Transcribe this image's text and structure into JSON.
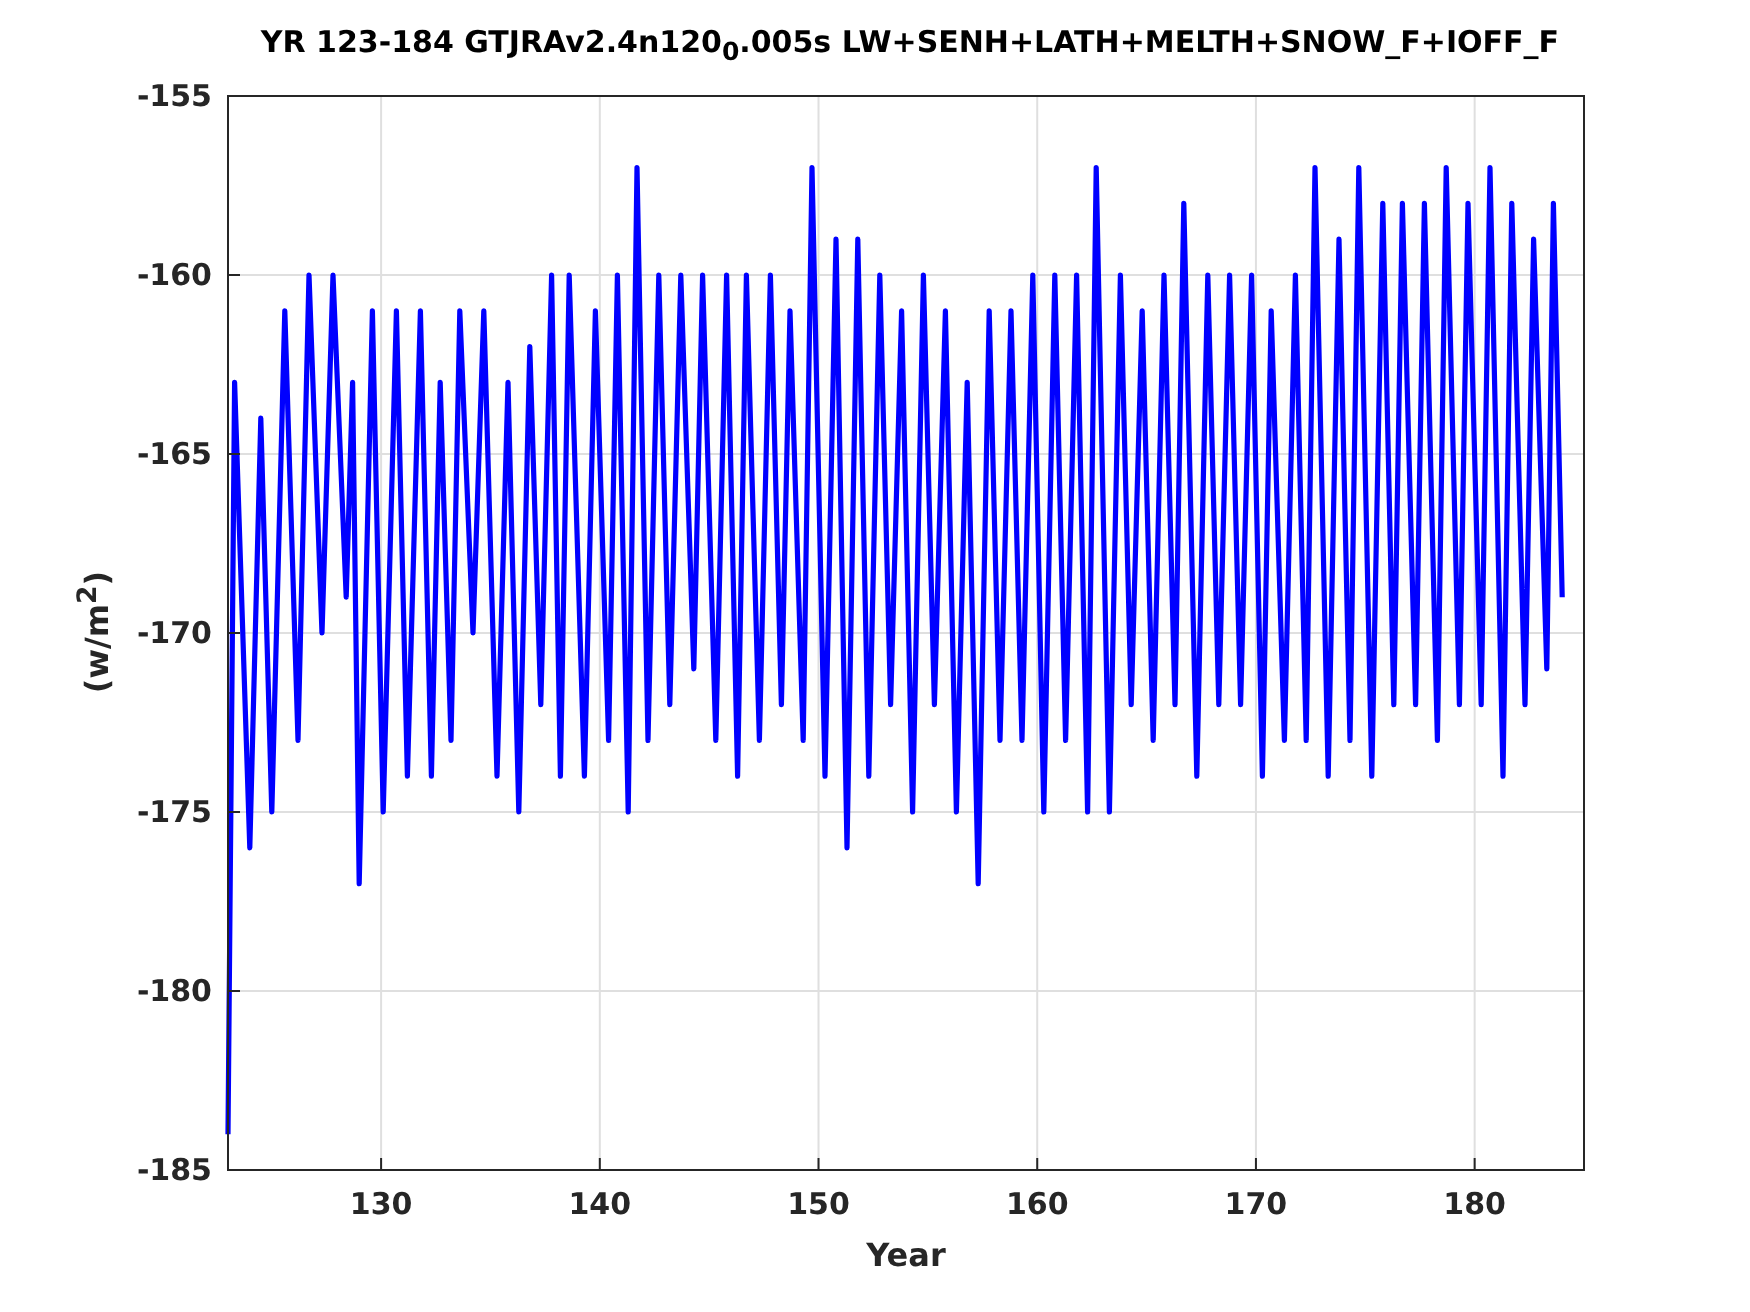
{
  "figure": {
    "chart_data": {
      "type": "line",
      "title": "YR 123-184 GTJRAv2.4n120$_{0}$.005s LW+SENH+LATH+MELTH+SNOW_F+IOFF_F",
      "xlabel": "Year",
      "ylabel": "(w/m$^{2}$)",
      "xlim": [
        123,
        185
      ],
      "ylim": [
        -185,
        -155
      ],
      "grid": true,
      "xticks": [
        130,
        140,
        150,
        160,
        170,
        180
      ],
      "yticks": [
        -185,
        -180,
        -175,
        -170,
        -165,
        -160,
        -155
      ],
      "x": [
        123,
        123.3,
        124,
        124.5,
        125,
        125.6,
        126.2,
        126.7,
        127.3,
        127.8,
        128.4,
        128.7,
        129,
        129.6,
        130.1,
        130.7,
        131.2,
        131.8,
        132.3,
        132.7,
        133.2,
        133.6,
        134.2,
        134.7,
        135.3,
        135.8,
        136.3,
        136.8,
        137.3,
        137.8,
        138.2,
        138.6,
        139.3,
        139.8,
        140.4,
        140.8,
        141.3,
        141.7,
        142.2,
        142.7,
        143.2,
        143.7,
        144.3,
        144.7,
        145.3,
        145.8,
        146.3,
        146.7,
        147.3,
        147.8,
        148.3,
        148.7,
        149.3,
        149.7,
        150.3,
        150.8,
        151.3,
        151.8,
        152.3,
        152.8,
        153.3,
        153.8,
        154.3,
        154.8,
        155.3,
        155.8,
        156.3,
        156.8,
        157.3,
        157.8,
        158.3,
        158.8,
        159.3,
        159.8,
        160.3,
        160.8,
        161.3,
        161.8,
        162.3,
        162.7,
        163.3,
        163.8,
        164.3,
        164.8,
        165.3,
        165.8,
        166.3,
        166.7,
        167.3,
        167.8,
        168.3,
        168.8,
        169.3,
        169.8,
        170.3,
        170.7,
        171.3,
        171.8,
        172.3,
        172.7,
        173.3,
        173.8,
        174.3,
        174.7,
        175.3,
        175.8,
        176.3,
        176.7,
        177.3,
        177.7,
        178.3,
        178.7,
        179.3,
        179.7,
        180.3,
        180.7,
        181.3,
        181.7,
        182.3,
        182.7,
        183.3,
        183.6,
        184
      ],
      "series": [
        {
          "color": "#0000ff",
          "values": [
            -184,
            -163,
            -176,
            -164,
            -175,
            -161,
            -173,
            -160,
            -170,
            -160,
            -169,
            -163,
            -177,
            -161,
            -175,
            -161,
            -174,
            -161,
            -174,
            -163,
            -173,
            -161,
            -170,
            -161,
            -174,
            -163,
            -175,
            -162,
            -172,
            -160,
            -174,
            -160,
            -174,
            -161,
            -173,
            -160,
            -175,
            -157,
            -173,
            -160,
            -172,
            -160,
            -171,
            -160,
            -173,
            -160,
            -174,
            -160,
            -173,
            -160,
            -172,
            -161,
            -173,
            -157,
            -174,
            -159,
            -176,
            -159,
            -174,
            -160,
            -172,
            -161,
            -175,
            -160,
            -172,
            -161,
            -175,
            -163,
            -177,
            -161,
            -173,
            -161,
            -173,
            -160,
            -175,
            -160,
            -173,
            -160,
            -175,
            -157,
            -175,
            -160,
            -172,
            -161,
            -173,
            -160,
            -172,
            -158,
            -174,
            -160,
            -172,
            -160,
            -172,
            -160,
            -174,
            -161,
            -173,
            -160,
            -173,
            -157,
            -174,
            -159,
            -173,
            -157,
            -174,
            -158,
            -172,
            -158,
            -172,
            -158,
            -173,
            -157,
            -172,
            -158,
            -172,
            -157,
            -174,
            -158,
            -172,
            -159,
            -171,
            -158,
            -169
          ]
        }
      ]
    }
  }
}
